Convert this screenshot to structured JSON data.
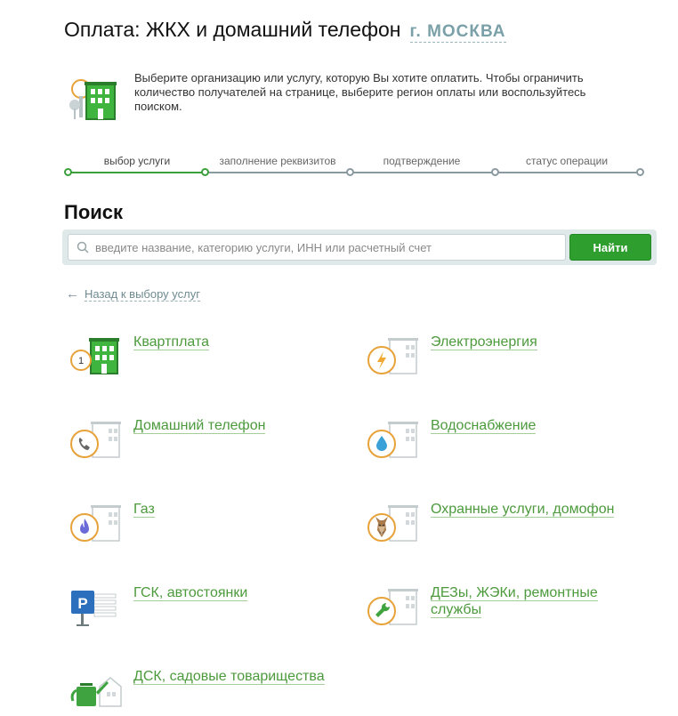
{
  "header": {
    "title": "Оплата: ЖКХ и домашний телефон",
    "region": "г. МОСКВА"
  },
  "intro": {
    "text": "Выберите организацию или услугу, которую Вы хотите оплатить. Чтобы ограничить количество получателей на странице, выберите регион оплаты или воспользуйтесь поиском."
  },
  "steps": [
    {
      "label": "выбор услуги",
      "state": "active"
    },
    {
      "label": "заполнение реквизитов",
      "state": "pending"
    },
    {
      "label": "подтверждение",
      "state": "pending"
    },
    {
      "label": "статус операции",
      "state": "pending"
    }
  ],
  "search": {
    "heading": "Поиск",
    "placeholder": "введите название, категорию услуги, ИНН или расчетный счет",
    "button_label": "Найти"
  },
  "back_link": {
    "label": "Назад к выбору услуг"
  },
  "services": [
    {
      "label": "Квартплата",
      "icon": "apartment-building-icon",
      "badge": "1"
    },
    {
      "label": "Электроэнергия",
      "icon": "lightning-icon"
    },
    {
      "label": "Домашний телефон",
      "icon": "phone-icon"
    },
    {
      "label": "Водоснабжение",
      "icon": "water-drop-icon"
    },
    {
      "label": "Газ",
      "icon": "gas-flame-icon"
    },
    {
      "label": "Охранные услуги, домофон",
      "icon": "guard-dog-icon"
    },
    {
      "label": "ГСК, автостоянки",
      "icon": "parking-icon"
    },
    {
      "label": "ДЕЗы, ЖЭКи, ремонтные службы",
      "icon": "wrench-icon"
    },
    {
      "label": "ДСК, садовые товарищества",
      "icon": "watering-can-icon"
    }
  ],
  "colors": {
    "accent_green": "#2e9e2e",
    "link_green": "#4c9a3c",
    "badge_orange": "#e8a23a",
    "region_blue": "#7aa0a8"
  }
}
